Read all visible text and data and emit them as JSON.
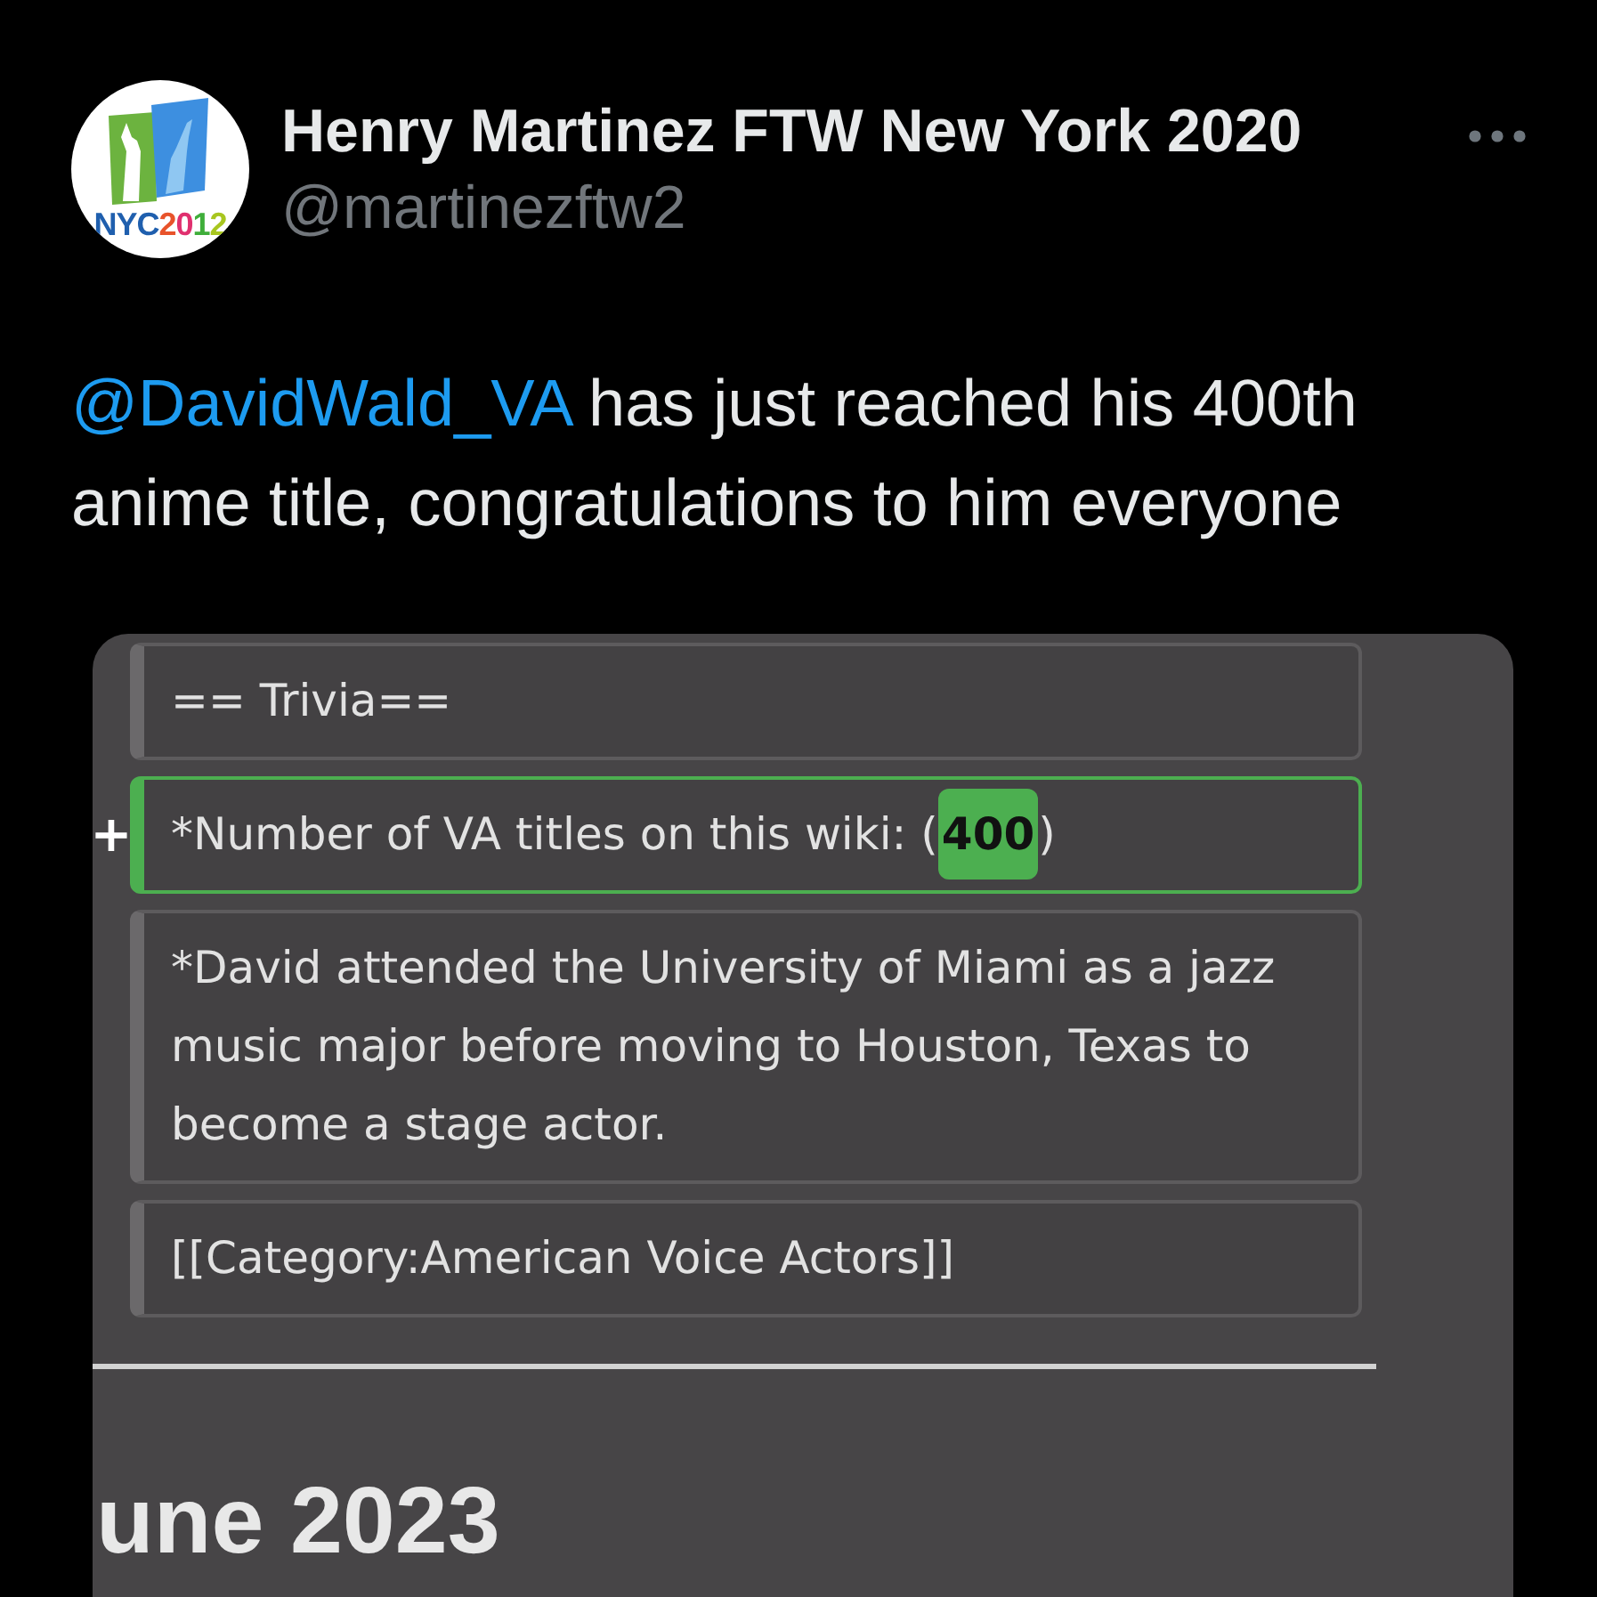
{
  "tweet": {
    "author": {
      "name": "Henry Martinez FTW New York 2020",
      "handle": "@martinezftw2",
      "avatar_logo_text": "NYC2012"
    },
    "text": {
      "mention": "@DavidWald_VA",
      "body": "has just reached his 400th anime title, congratulations to him everyone"
    },
    "media": {
      "lines": [
        {
          "kind": "context",
          "text": "== Trivia=="
        },
        {
          "kind": "added",
          "marker": "+",
          "text": "*Number of VA titles on this wiki: (",
          "highlight": "400",
          "text_after": ")"
        },
        {
          "kind": "context",
          "text": "*David attended the University of Miami as a jazz music major before moving to Houston, Texas to become a stage actor."
        },
        {
          "kind": "context",
          "text": "[[Category:American Voice Actors]]"
        }
      ],
      "heading": "une 2023"
    }
  }
}
